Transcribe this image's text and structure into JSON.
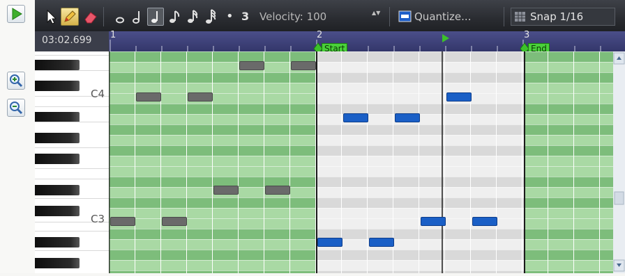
{
  "toolbar": {
    "dot_label": "•",
    "tuplet_value": "3",
    "velocity_label": "Velocity: 100",
    "velocity_arrows": "▲▼",
    "quantize_label": "Quantize...",
    "snap_label": "Snap 1/16",
    "tools": [
      "select-arrow-icon",
      "pencil-icon",
      "eraser-icon"
    ],
    "durations": [
      "whole-note-icon",
      "half-note-icon",
      "quarter-note-icon",
      "eighth-note-icon",
      "sixteenth-note-icon",
      "thirtysecond-note-icon"
    ],
    "selected_duration": "quarter-note-icon"
  },
  "ruler": {
    "time": "03:02.699",
    "bars": [
      "1",
      "2",
      "3"
    ],
    "start_label": "Start",
    "end_label": "End"
  },
  "piano": {
    "c4_label": "C4",
    "c3_label": "C3"
  },
  "colors": {
    "loop_dark": "#7dbd7b",
    "loop_light": "#a9d9a4",
    "out_dark": "#d9d9d9",
    "out_light": "#efefef",
    "note_blue": "#1a5fc6",
    "note_gray": "#6a6a6a",
    "marker_green": "#39c12a"
  }
}
